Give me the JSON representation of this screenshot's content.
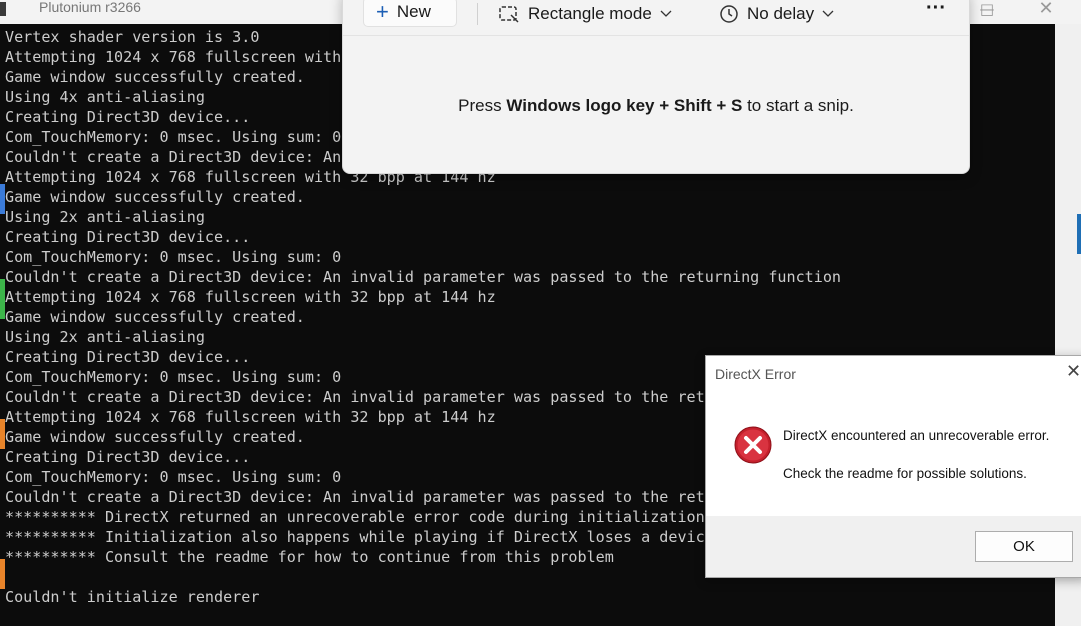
{
  "console": {
    "title": "Plutonium r3266",
    "lines": [
      "Vertex shader version is 3.0",
      "Attempting 1024 x 768 fullscreen with",
      "Game window successfully created.",
      "Using 4x anti-aliasing",
      "Creating Direct3D device...",
      "Com_TouchMemory: 0 msec. Using sum: 0",
      "Couldn't create a Direct3D device: An",
      "Attempting 1024 x 768 fullscreen with 32 bpp at 144 hz",
      "Game window successfully created.",
      "Using 2x anti-aliasing",
      "Creating Direct3D device...",
      "Com_TouchMemory: 0 msec. Using sum: 0",
      "Couldn't create a Direct3D device: An invalid parameter was passed to the returning function",
      "Attempting 1024 x 768 fullscreen with 32 bpp at 144 hz",
      "Game window successfully created.",
      "Using 2x anti-aliasing",
      "Creating Direct3D device...",
      "Com_TouchMemory: 0 msec. Using sum: 0",
      "Couldn't create a Direct3D device: An invalid parameter was passed to the retu",
      "Attempting 1024 x 768 fullscreen with 32 bpp at 144 hz",
      "Game window successfully created.",
      "Creating Direct3D device...",
      "Com_TouchMemory: 0 msec. Using sum: 0",
      "Couldn't create a Direct3D device: An invalid parameter was passed to the retu",
      "********** DirectX returned an unrecoverable error code during initialization",
      "********** Initialization also happens while playing if DirectX loses a device",
      "********** Consult the readme for how to continue from this problem",
      "",
      "Couldn't initialize renderer"
    ]
  },
  "snipping_tool": {
    "new_label": "New",
    "mode_label": "Rectangle mode",
    "delay_label": "No delay",
    "more_label": "···",
    "message_prefix": "Press ",
    "message_keys": "Windows logo key + Shift + S",
    "message_suffix": " to start a snip."
  },
  "dialog": {
    "title": "DirectX Error",
    "message": "DirectX encountered an unrecoverable error.",
    "hint": "Check the readme for possible solutions.",
    "ok_label": "OK"
  }
}
